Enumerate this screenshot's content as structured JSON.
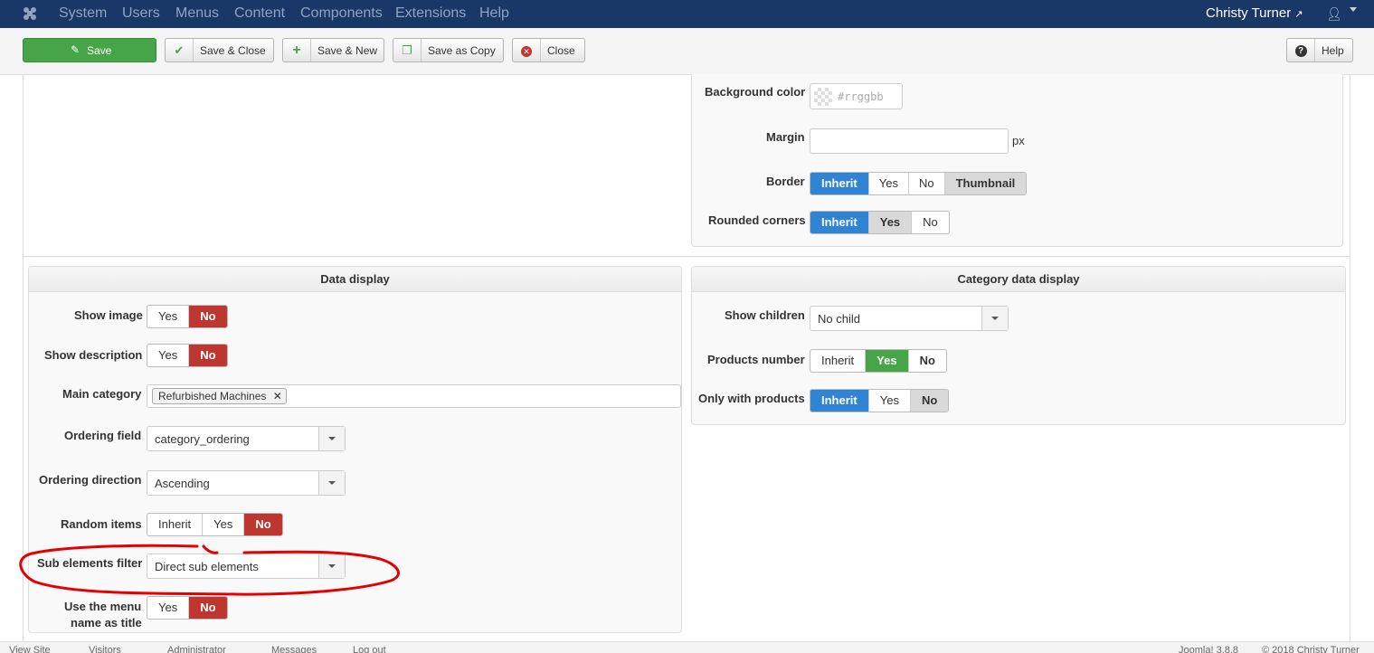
{
  "topbar": {
    "menu": [
      "System",
      "Users",
      "Menus",
      "Content",
      "Components",
      "Extensions",
      "Help"
    ],
    "user_name": "Christy Turner"
  },
  "toolbar": {
    "save": "Save",
    "save_close": "Save & Close",
    "save_new": "Save & New",
    "save_copy": "Save as Copy",
    "close": "Close",
    "help": "Help"
  },
  "image_settings": {
    "background_color_label": "Background color",
    "background_color_placeholder": "#rrggbb",
    "margin_label": "Margin",
    "margin_value": "",
    "margin_unit": "px",
    "border_label": "Border",
    "border_options": [
      "Inherit",
      "Yes",
      "No",
      "Thumbnail"
    ],
    "rounded_label": "Rounded corners",
    "rounded_options": [
      "Inherit",
      "Yes",
      "No"
    ]
  },
  "data_display": {
    "title": "Data display",
    "show_image_label": "Show image",
    "show_description_label": "Show description",
    "main_category_label": "Main category",
    "main_category_tag": "Refurbished Machines",
    "ordering_field_label": "Ordering field",
    "ordering_field_value": "category_ordering",
    "ordering_direction_label": "Ordering direction",
    "ordering_direction_value": "Ascending",
    "random_items_label": "Random items",
    "sub_elements_label": "Sub elements filter",
    "sub_elements_value": "Direct sub elements",
    "menu_title_label_1": "Use the menu",
    "menu_title_label_2": "name as title",
    "yes": "Yes",
    "no": "No",
    "inherit": "Inherit"
  },
  "category_display": {
    "title": "Category data display",
    "show_children_label": "Show children",
    "show_children_value": "No child",
    "products_number_label": "Products number",
    "only_products_label": "Only with products",
    "inherit": "Inherit",
    "yes": "Yes",
    "no": "No"
  },
  "statusbar": {
    "left": "View Site",
    "visitors": "Visitors",
    "admin": "Administrator",
    "messages": "Messages",
    "logout": "Log out",
    "version": "Joomla! 3.8.8",
    "copyright": "© 2018 Christy Turner"
  },
  "colors": {
    "navbar": "#1a3867",
    "save_green": "#46a546",
    "active_blue": "#2f85d3",
    "no_red": "#bd362f",
    "annotation_red": "#e60000"
  }
}
